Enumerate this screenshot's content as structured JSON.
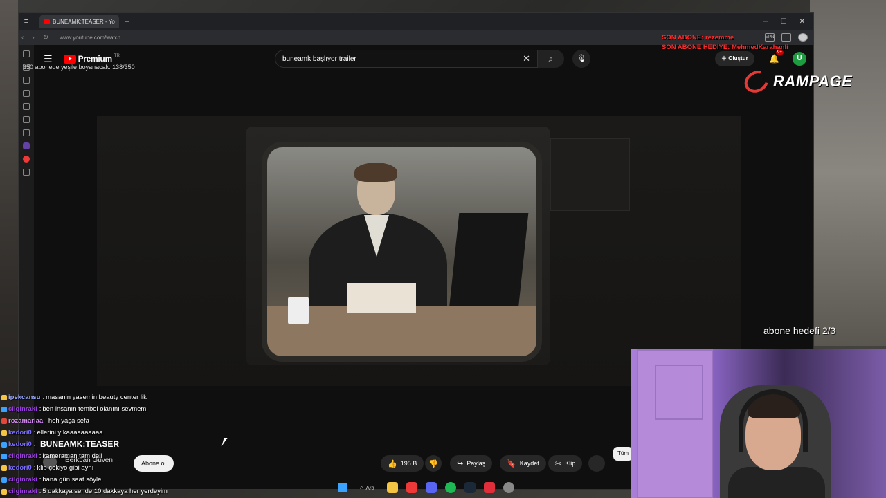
{
  "browser": {
    "tab_title": "BUNEAMK:TEASER - YouTub",
    "new_tab": "+",
    "url": "www.youtube.com/watch",
    "vpn_label": "VPN"
  },
  "youtube": {
    "logo_text": "Premium",
    "logo_region": "TR",
    "search_query": "buneamk başlıyor trailer",
    "create_label": "Oluştur",
    "notif_badge": "9+",
    "avatar_letter": "U",
    "video_title": "BUNEAMK:TEASER",
    "channel_name": "Berkcan Güven",
    "subscribe_label": "Abone ol",
    "like_count": "195 B",
    "share_label": "Paylaş",
    "save_label": "Kaydet",
    "clip_label": "Klip",
    "more_label": "...",
    "chip_label": "Tüm"
  },
  "overlay": {
    "sub_goal_text": "350 abonede yeşile boyanacak: 138/350",
    "son_abone": "SON ABONE: rezemme",
    "son_abone_hediye": "SON ABONE HEDİYE: MehmedKarahanli",
    "brand": "RAMPAGE",
    "abone_hedefi": "abone hedefi 2/3"
  },
  "chat": [
    {
      "user": "ipekcansu",
      "message": "masanin yasemin beauty center lik",
      "color": "#9aa8ff",
      "badge": "#f4c542"
    },
    {
      "user": "cilginraki",
      "message": "ben insanın tembel olanını sevmem",
      "color": "#9b3fe0",
      "badge": "#3aa3ff"
    },
    {
      "user": "rozamariaa",
      "message": "heh yaşa sefa",
      "color": "#d28cf0",
      "badge": "#e0483a"
    },
    {
      "user": "kedori0",
      "message": "ellerini yıkaaaaaaaaaa",
      "color": "#7a6cff",
      "badge": "#f4c542"
    },
    {
      "user": "kedori0",
      "message": " ",
      "color": "#7a6cff",
      "badge": "#3aa3ff"
    },
    {
      "user": "cilginraki",
      "message": "kameraman tam deli",
      "color": "#9b3fe0",
      "badge": "#3aa3ff"
    },
    {
      "user": "kedori0",
      "message": "klip çekiyo gibi aynı",
      "color": "#7a6cff",
      "badge": "#f4c542"
    },
    {
      "user": "cilginraki",
      "message": "bana gün saat söyle",
      "color": "#9b3fe0",
      "badge": "#3aa3ff"
    },
    {
      "user": "cilginraki",
      "message": "5 dakkaya sende 10 dakkaya her yerdeyim",
      "color": "#9b3fe0",
      "badge": "#f4c542"
    }
  ],
  "taskbar": {
    "search_label": "Ara"
  },
  "colors": {
    "yt_red": "#ff0000",
    "son_abone_red": "#ff2a2a",
    "rampage_red": "#e53935"
  }
}
